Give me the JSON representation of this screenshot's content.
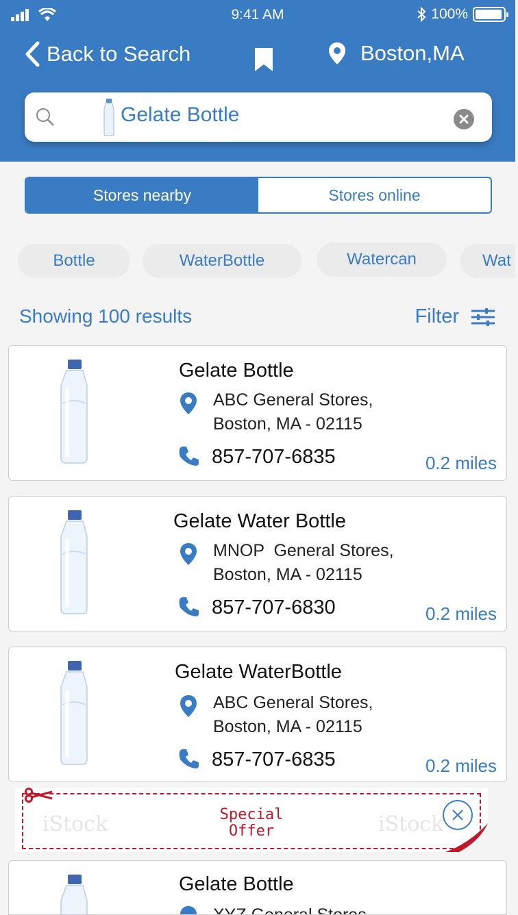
{
  "status_bar": {
    "time": "9:41 AM",
    "battery": "100%"
  },
  "header": {
    "back_label": "Back to Search",
    "location": "Boston,MA"
  },
  "search": {
    "query": "Gelate Bottle"
  },
  "segments": {
    "active": "Stores nearby",
    "inactive": "Stores online"
  },
  "chips": [
    "Bottle",
    "WaterBottle",
    "Watercan",
    "Wat"
  ],
  "results": {
    "count_text": "Showing 100 results",
    "filter_label": "Filter"
  },
  "cards": [
    {
      "title": "Gelate Bottle",
      "store_line1": "ABC General Stores,",
      "store_line2": "Boston, MA - 02115",
      "phone": "857-707-6835",
      "distance": "0.2 miles"
    },
    {
      "title": "Gelate Water Bottle",
      "store_line1": "MNOP  General Stores,",
      "store_line2": "Boston, MA - 02115",
      "phone": "857-707-6830",
      "distance": "0.2 miles"
    },
    {
      "title": "Gelate WaterBottle",
      "store_line1": "ABC General Stores,",
      "store_line2": "Boston, MA - 02115",
      "phone": "857-707-6835",
      "distance": "0.2 miles"
    },
    {
      "title": "Gelate Bottle",
      "store_line1": "XYZ General Stores,",
      "store_line2": "",
      "phone": "",
      "distance": ""
    }
  ],
  "offer": {
    "line1": "Special",
    "line2": "Offer",
    "watermark": "iStock"
  },
  "colors": {
    "brand": "#3a7cc3",
    "offer_red": "#c0182b"
  },
  "icons": [
    "signal-icon",
    "wifi-icon",
    "bluetooth-icon",
    "battery-icon",
    "chevron-left-icon",
    "bookmark-icon",
    "map-pin-icon",
    "search-icon",
    "clear-icon",
    "filter-icon",
    "phone-icon",
    "scissors-icon",
    "close-icon"
  ]
}
